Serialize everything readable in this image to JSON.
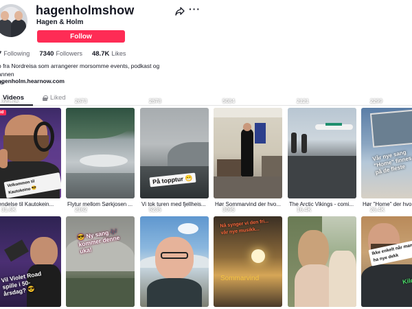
{
  "profile": {
    "username": "hagenholmshow",
    "nickname": "Hagen & Holm",
    "follow_label": "Follow",
    "stats": {
      "following_count": "7",
      "following_label": "Following",
      "followers_count": "7340",
      "followers_label": "Followers",
      "likes_count": "48.7K",
      "likes_label": "Likes"
    },
    "bio": "o fra Nordreisa som arrangerer morsomme events, podkast og annen\nro",
    "link": "agenholm.hearnow.com"
  },
  "tabs": {
    "videos": "Videos",
    "liked": "Liked"
  },
  "icons": {
    "share": "share-icon",
    "more": "more-icon",
    "lock": "lock-icon",
    "play": "play-icon"
  },
  "colors": {
    "accent": "#fe2c55",
    "text": "#161823",
    "muted": "#8a8b91"
  },
  "videos": [
    {
      "views": "323.1K",
      "caption": "rsendelse til Kautokein...",
      "badge": "nned",
      "overlay": ""
    },
    {
      "views": "2673",
      "caption": "Flytur mellom Sørkjosen ...",
      "badge": "",
      "overlay": ""
    },
    {
      "views": "2578",
      "caption": "Vi tok turen med fjellheis...",
      "badge": "",
      "overlay": "På topptur 😁"
    },
    {
      "views": "5084",
      "caption": "Hør Sommarvind der hvo...",
      "badge": "",
      "overlay": ""
    },
    {
      "views": "2121",
      "caption": "The Arctic Vikings - comi...",
      "badge": "",
      "overlay": ""
    },
    {
      "views": "2299",
      "caption": "Hør \"Home\" der hvo...",
      "badge": "",
      "overlay": "Vår nye sang \"Home\" finnes nå på de fleste"
    },
    {
      "views": "31.6K",
      "caption": "",
      "badge": "",
      "overlay": "Vil Violet Road spille i 50-årsdag? 😎"
    },
    {
      "views": "2162",
      "caption": "",
      "badge": "",
      "overlay": "😎 Ny sang 🎶 kommer denne uka!"
    },
    {
      "views": "5235",
      "caption": "",
      "badge": "",
      "overlay": ""
    },
    {
      "views": "3095",
      "caption": "",
      "badge": "",
      "overlay": "Nå synger vi den fri... vår nye musikk...",
      "overlay2": "Sommarvind"
    },
    {
      "views": "16.4K",
      "caption": "",
      "badge": "",
      "overlay": ""
    },
    {
      "views": "26.4K",
      "caption": "",
      "badge": "",
      "overlay": "Ikke enkelt når man skal ha nye dekk",
      "overlay2": "Kildord"
    }
  ]
}
